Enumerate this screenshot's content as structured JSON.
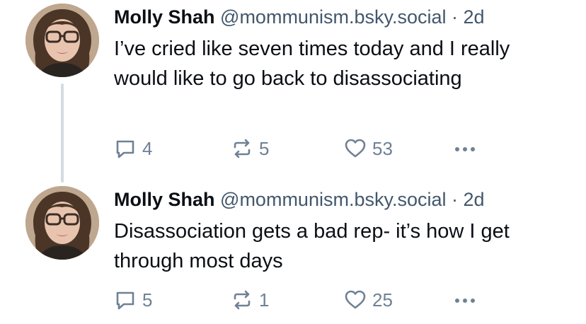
{
  "posts": [
    {
      "author_name": "Molly Shah",
      "handle": "@mommunism.bsky.social",
      "separator": "·",
      "time": "2d",
      "text": "I’ve cried like seven times today and I really would like to go back to disassociating",
      "replies": "4",
      "reposts": "5",
      "likes": "53"
    },
    {
      "author_name": "Molly Shah",
      "handle": "@mommunism.bsky.social",
      "separator": "·",
      "time": "2d",
      "text": "Disassociation gets a bad rep- it’s how I get through most days",
      "replies": "5",
      "reposts": "1",
      "likes": "25"
    }
  ],
  "icons": {
    "reply": "reply-icon",
    "repost": "repost-icon",
    "like": "heart-icon",
    "more": "more-options-icon"
  },
  "colors": {
    "text_primary": "#0b0f14",
    "text_secondary": "#42576c",
    "icon_gray": "#6f8194",
    "thread_line": "#d4dbe2"
  }
}
